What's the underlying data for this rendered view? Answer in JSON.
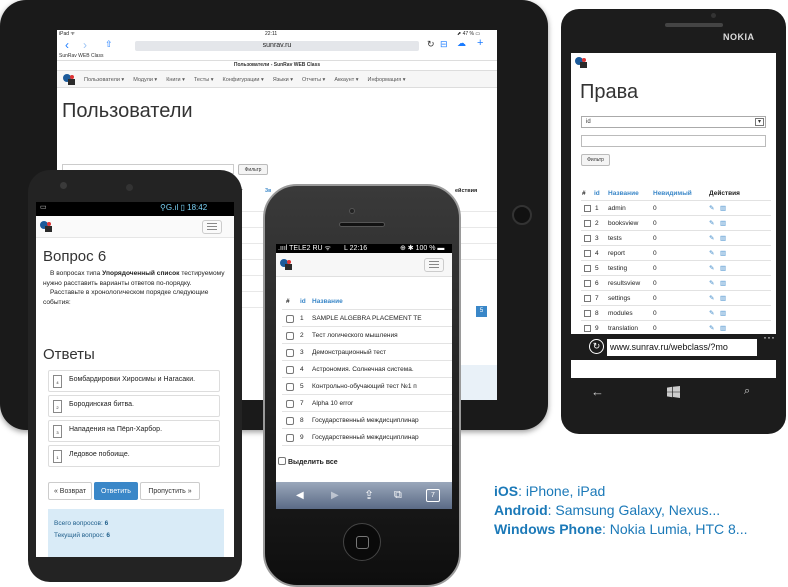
{
  "ipad": {
    "status_left": "iPad ᯤ",
    "status_time": "22:11",
    "status_right": "⬈ 47 % ▭",
    "url": "sunrav.ru",
    "tab_title": "SunRav WEB Class",
    "page_tab_title": "Пользователи - SunRav WEB Class",
    "nav_items": [
      "Пользователи ▾",
      "Модули ▾",
      "Книги ▾",
      "Тесты ▾",
      "Конфигурации ▾",
      "Языки ▾",
      "Отчеты ▾",
      "Аккаунт ▾",
      "Информация ▾"
    ],
    "heading": "Пользователи",
    "filter_label": "Фильтр",
    "col_partial_1": "tor",
    "col_partial_2": "Зв",
    "col_actions": "ействия"
  },
  "android": {
    "status_right": "⚲G.ıl ▯ 18:42",
    "question_title": "Вопрос 6",
    "question_text_prefix": "В вопросах типа ",
    "question_text_bold": "Упорядоченный список",
    "question_text_rest": " тестируемому нужно расставить варианты ответов по-порядку.",
    "question_text_2": "Расставьте в хронологическом порядке следующие события:",
    "answers_title": "Ответы",
    "answers": [
      {
        "num": "4",
        "label": "Бомбардировки Хиросимы и Нагасаки."
      },
      {
        "num": "2",
        "label": "Бородинская битва."
      },
      {
        "num": "3",
        "label": "Нападения на Пёрл-Харбор."
      },
      {
        "num": "1",
        "label": "Ледовое побоище."
      }
    ],
    "btn_back": "« Возврат",
    "btn_answer": "Ответить",
    "btn_skip": "Пропустить »",
    "total_label": "Всего вопросов: ",
    "total_value": "6",
    "current_label": "Текущий вопрос: ",
    "current_value": "6"
  },
  "iphone": {
    "status_carrier": ".ıııl TELE2 RU ᯤ",
    "status_time": "L 22:16",
    "status_right": "⊕ ✱ 100 % ▬",
    "col_hash": "#",
    "col_id": "id",
    "col_name": "Название",
    "rows": [
      {
        "id": "1",
        "name": "SAMPLE ALGEBRA PLACEMENT TE"
      },
      {
        "id": "2",
        "name": "Тест логического мышления"
      },
      {
        "id": "3",
        "name": "Демонстрационный тест"
      },
      {
        "id": "4",
        "name": "Астрономия. Солнечная система."
      },
      {
        "id": "5",
        "name": "Контрольно-обучающий тест №1 п"
      },
      {
        "id": "7",
        "name": "Alpha 10 error"
      },
      {
        "id": "8",
        "name": "Государственный междисциплинар"
      },
      {
        "id": "9",
        "name": "Государственный междисциплинар"
      }
    ],
    "select_all": "Выделить все",
    "page_badge": "5"
  },
  "nokia": {
    "brand": "NOKIA",
    "heading": "Права",
    "select_value": "id",
    "filter_label": "Фильтр",
    "col_hash": "#",
    "col_id": "id",
    "col_name": "Название",
    "col_invisible": "Невидимый",
    "col_actions": "Действия",
    "rows": [
      {
        "id": "1",
        "name": "admin",
        "inv": "0"
      },
      {
        "id": "2",
        "name": "booksview",
        "inv": "0"
      },
      {
        "id": "3",
        "name": "tests",
        "inv": "0"
      },
      {
        "id": "4",
        "name": "report",
        "inv": "0"
      },
      {
        "id": "5",
        "name": "testing",
        "inv": "0"
      },
      {
        "id": "6",
        "name": "resultsview",
        "inv": "0"
      },
      {
        "id": "7",
        "name": "settings",
        "inv": "0"
      },
      {
        "id": "8",
        "name": "modules",
        "inv": "0"
      },
      {
        "id": "9",
        "name": "translation",
        "inv": "0"
      }
    ],
    "url": "www.sunrav.ru/webclass/?mo"
  },
  "caption": {
    "line1_bold": "iOS",
    "line1_rest": ": iPhone, iPad",
    "line2_bold": "Android",
    "line2_rest": ": Samsung Galaxy, Nexus...",
    "line3_bold": "Windows Phone",
    "line3_rest": ": Nokia Lumia, HTC 8..."
  },
  "colors": {
    "accent": "#3a87c8",
    "caption": "#1b79b8"
  }
}
